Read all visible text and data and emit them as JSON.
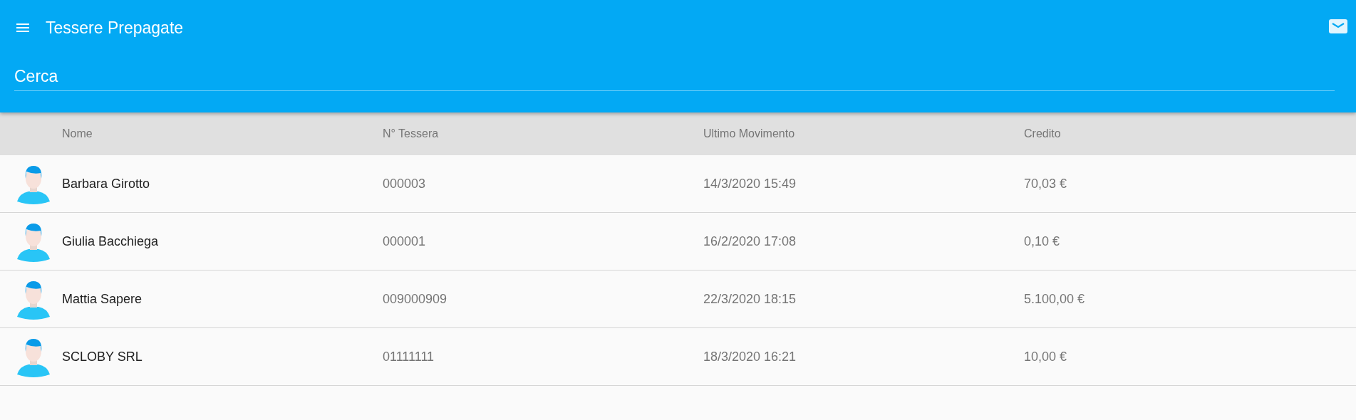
{
  "app_bar": {
    "title": "Tessere Prepagate"
  },
  "search": {
    "placeholder": "Cerca"
  },
  "table": {
    "columns": [
      "Nome",
      "N° Tessera",
      "Ultimo Movimento",
      "Credito"
    ],
    "rows": [
      {
        "name": "Barbara Girotto",
        "card_number": "000003",
        "last_movement": "14/3/2020 15:49",
        "credit": "70,03 €"
      },
      {
        "name": "Giulia Bacchiega",
        "card_number": "000001",
        "last_movement": "16/2/2020 17:08",
        "credit": "0,10 €"
      },
      {
        "name": "Mattia Sapere",
        "card_number": "009000909",
        "last_movement": "22/3/2020 18:15",
        "credit": "5.100,00 €"
      },
      {
        "name": "SCLOBY SRL",
        "card_number": "01111111",
        "last_movement": "18/3/2020 16:21",
        "credit": "10,00 €"
      }
    ]
  }
}
